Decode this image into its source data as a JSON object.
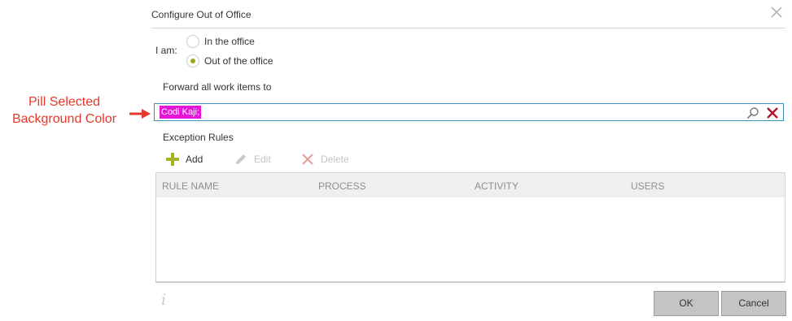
{
  "annotation": {
    "line1": "Pill Selected",
    "line2": "Background Color",
    "color": "#e8382b"
  },
  "dialog": {
    "title": "Configure Out of Office",
    "close_icon": "close-x-icon"
  },
  "status": {
    "label": "I am:",
    "options": [
      {
        "label": "In the office",
        "selected": false
      },
      {
        "label": "Out of the office",
        "selected": true
      }
    ]
  },
  "forward": {
    "label": "Forward all work items to",
    "pill": "Codi Kaji;",
    "pill_color": "#e616d9",
    "search_icon": "search-icon",
    "clear_icon": "clear-x-icon"
  },
  "exceptions": {
    "label": "Exception Rules",
    "toolbar": {
      "add": "Add",
      "edit": "Edit",
      "delete": "Delete"
    },
    "columns": [
      "RULE NAME",
      "PROCESS",
      "ACTIVITY",
      "USERS"
    ],
    "rows": []
  },
  "footer": {
    "info_icon": "info-icon",
    "ok": "OK",
    "cancel": "Cancel"
  }
}
